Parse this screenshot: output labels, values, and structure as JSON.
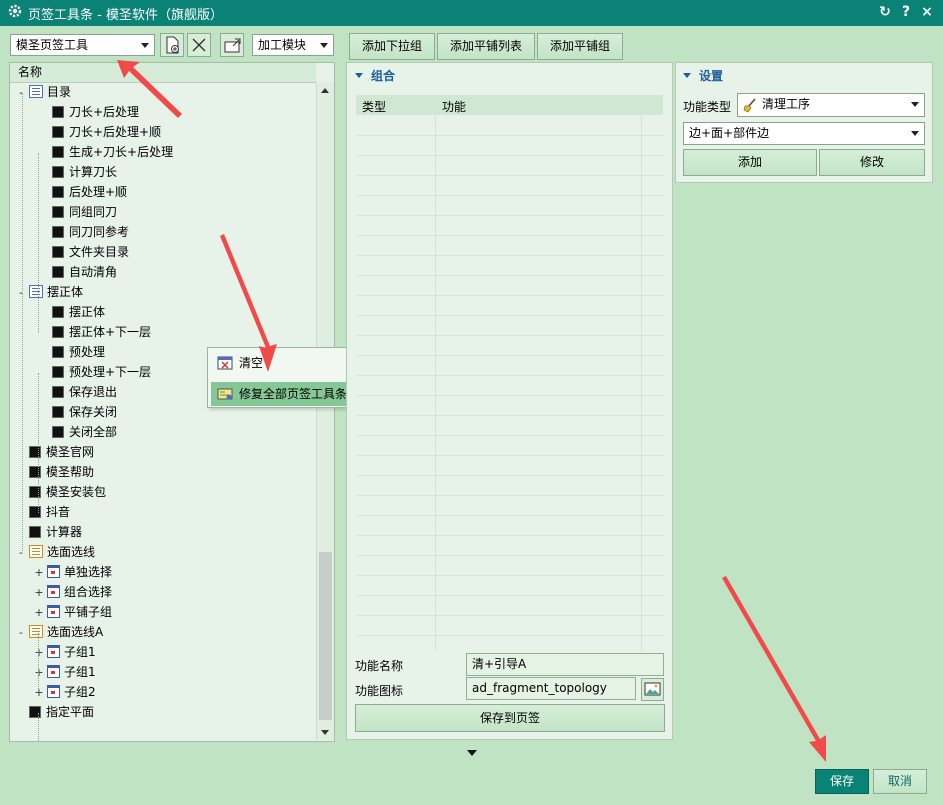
{
  "window": {
    "title": "页签工具条 - 模圣软件（旗舰版）",
    "buttons": {
      "refresh": "↻",
      "help": "?",
      "close": "×"
    }
  },
  "toolbar": {
    "toolbar_select": "模圣页签工具",
    "module_select": "加工模块",
    "tabs": [
      "添加下拉组",
      "添加平铺列表",
      "添加平铺组"
    ]
  },
  "tree": {
    "header": "名称",
    "items": [
      {
        "label": "目录",
        "level": 0,
        "kind": "folder",
        "expander": "-"
      },
      {
        "label": "刀长+后处理",
        "level": 1,
        "kind": "item"
      },
      {
        "label": "刀长+后处理+顺",
        "level": 1,
        "kind": "item"
      },
      {
        "label": "生成+刀长+后处理",
        "level": 1,
        "kind": "item"
      },
      {
        "label": "计算刀长",
        "level": 1,
        "kind": "item"
      },
      {
        "label": "后处理+顺",
        "level": 1,
        "kind": "item"
      },
      {
        "label": "同组同刀",
        "level": 1,
        "kind": "item"
      },
      {
        "label": "同刀同参考",
        "level": 1,
        "kind": "item"
      },
      {
        "label": "文件夹目录",
        "level": 1,
        "kind": "item"
      },
      {
        "label": "自动清角",
        "level": 1,
        "kind": "item"
      },
      {
        "label": "摆正体",
        "level": 0,
        "kind": "folder",
        "expander": "-"
      },
      {
        "label": "摆正体",
        "level": 1,
        "kind": "item"
      },
      {
        "label": "摆正体+下一层",
        "level": 1,
        "kind": "item"
      },
      {
        "label": "预处理",
        "level": 1,
        "kind": "item"
      },
      {
        "label": "预处理+下一层",
        "level": 1,
        "kind": "item"
      },
      {
        "label": "保存退出",
        "level": 1,
        "kind": "item"
      },
      {
        "label": "保存关闭",
        "level": 1,
        "kind": "item"
      },
      {
        "label": "关闭全部",
        "level": 1,
        "kind": "item"
      },
      {
        "label": "模圣官网",
        "level": 0,
        "kind": "item"
      },
      {
        "label": "模圣帮助",
        "level": 0,
        "kind": "item"
      },
      {
        "label": "模圣安装包",
        "level": 0,
        "kind": "item"
      },
      {
        "label": "抖音",
        "level": 0,
        "kind": "item"
      },
      {
        "label": "计算器",
        "level": 0,
        "kind": "item"
      },
      {
        "label": "选面选线",
        "level": 0,
        "kind": "folder-orange",
        "expander": "-"
      },
      {
        "label": "单独选择",
        "level": 1,
        "kind": "cal",
        "expander": "+"
      },
      {
        "label": "组合选择",
        "level": 1,
        "kind": "cal",
        "expander": "+"
      },
      {
        "label": "平铺子组",
        "level": 1,
        "kind": "cal",
        "expander": "+"
      },
      {
        "label": "选面选线A",
        "level": 0,
        "kind": "folder-orange",
        "expander": "-"
      },
      {
        "label": "子组1",
        "level": 1,
        "kind": "cal",
        "expander": "+"
      },
      {
        "label": "子组1",
        "level": 1,
        "kind": "cal",
        "expander": "+"
      },
      {
        "label": "子组2",
        "level": 1,
        "kind": "cal",
        "expander": "+"
      },
      {
        "label": "指定平面",
        "level": 0,
        "kind": "item"
      }
    ]
  },
  "context_menu": {
    "items": [
      {
        "label": "清空",
        "highlighted": false
      },
      {
        "label": "修复全部页签工具条",
        "highlighted": true
      }
    ]
  },
  "group_panel": {
    "title": "组合",
    "columns": [
      "类型",
      "功能"
    ],
    "func_name_label": "功能名称",
    "func_name_value": "清+引导A",
    "func_icon_label": "功能图标",
    "func_icon_value": "ad_fragment_topology",
    "save_to_tab": "保存到页签"
  },
  "settings": {
    "title": "设置",
    "func_type_label": "功能类型",
    "func_type_value": "清理工序",
    "edge_select": "边+面+部件边",
    "add": "添加",
    "modify": "修改"
  },
  "footer": {
    "save": "保存",
    "cancel": "取消"
  },
  "colors": {
    "titlebar": "#0b8276",
    "background": "#bfe3c3",
    "panel": "#e7f3e8",
    "highlight": "#85c896",
    "annotation_arrow": "#f04a4a"
  }
}
